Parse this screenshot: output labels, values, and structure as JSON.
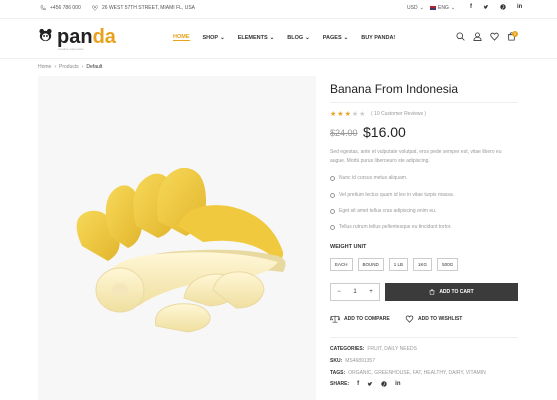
{
  "topbar": {
    "phone": "+456 786 000",
    "address": "26 WEST 57TH STREET, MIAMI FL, USA",
    "currency": "USD",
    "language": "ENG"
  },
  "logo": {
    "part1": "pan",
    "part2": "da",
    "tagline": "creative responsive"
  },
  "nav": [
    {
      "label": "HOME"
    },
    {
      "label": "SHOP"
    },
    {
      "label": "ELEMENTS"
    },
    {
      "label": "BLOG"
    },
    {
      "label": "PAGES"
    },
    {
      "label": "BUY PANDA!"
    }
  ],
  "cart_count": "0",
  "breadcrumb": {
    "home": "Home",
    "products": "Products",
    "current": "Default"
  },
  "product": {
    "title": "Banana From Indonesia",
    "rating": 3,
    "rating_max": 5,
    "reviews": "( 10 Customer Reviews )",
    "old_price": "$24.00",
    "price": "$16.00",
    "description": "Sed egestas, ante et vulputate volutpat, eros pede semper est, vitae libero eu augue. Morbi purus liberoeuro ste adipiscing.",
    "features": [
      "Nunc id cursus metus aliquam.",
      "Vel pretium lectus quam id leo in vitae turpis massa.",
      "Eget sit amet tellus cras adipiscing enim eu.",
      "Tellus rutrum tellus pellentesque eu tincidunt tortor."
    ],
    "weight_label": "WEIGHT UNIT",
    "weights": [
      "EACH",
      "BOUND",
      "1 LB",
      "1KG",
      "500G"
    ],
    "qty": "1",
    "add_to_cart": "ADD TO CART",
    "add_to_compare": "ADD TO COMPARE",
    "add_to_wishlist": "ADD TO WISHLIST",
    "categories_label": "CATEGORIES:",
    "categories": "FRUIT, DAILY NEEDS",
    "sku_label": "SKU:",
    "sku": "MS46891357",
    "tags_label": "TAGS:",
    "tags": "ORGANIC, GREENHOUSE, FAT, HEALTHY, DAIRY, VITAMIN",
    "share_label": "SHARE:"
  },
  "colors": {
    "accent": "#e8a21c",
    "dark": "#3b3b3b",
    "banana": "#f2c94c"
  }
}
